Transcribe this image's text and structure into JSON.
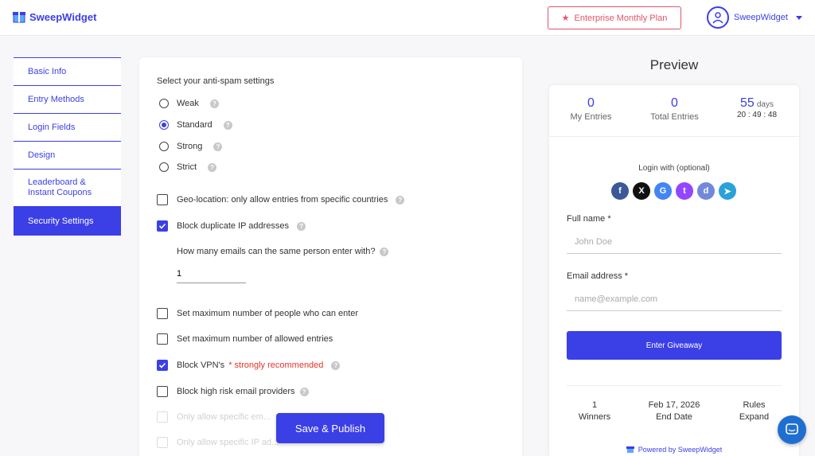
{
  "header": {
    "logo_text": "SweepWidget",
    "plan_label": "Enterprise Monthly Plan",
    "user_name": "SweepWidget"
  },
  "sidebar": {
    "items": [
      {
        "label": "Basic Info"
      },
      {
        "label": "Entry Methods"
      },
      {
        "label": "Login Fields"
      },
      {
        "label": "Design"
      },
      {
        "label": "Leaderboard &",
        "label2": "Instant Coupons"
      },
      {
        "label": "Security Settings",
        "active": true
      }
    ]
  },
  "security": {
    "title": "Select your anti-spam settings",
    "levels": [
      {
        "label": "Weak",
        "selected": false
      },
      {
        "label": "Standard",
        "selected": true
      },
      {
        "label": "Strong",
        "selected": false
      },
      {
        "label": "Strict",
        "selected": false
      }
    ],
    "options": [
      {
        "label": "Geo-location: only allow entries from specific countries",
        "checked": false
      },
      {
        "label": "Block duplicate IP addresses",
        "checked": true
      },
      {
        "label": "Set maximum number of people who can enter",
        "checked": false
      },
      {
        "label": "Set maximum number of allowed entries",
        "checked": false
      },
      {
        "label": "Block VPN's",
        "checked": true,
        "note": "* strongly recommended"
      },
      {
        "label": "Block high risk email providers",
        "checked": false
      },
      {
        "label": "Only allow specific em...",
        "checked": false
      },
      {
        "label": "Only allow specific IP ad...",
        "checked": false
      }
    ],
    "emails_question": "How many emails can the same person enter with?",
    "emails_value": "1",
    "publish_label": "Save & Publish"
  },
  "preview": {
    "title": "Preview",
    "stats": {
      "my_entries": "0",
      "my_entries_label": "My Entries",
      "total_entries": "0",
      "total_entries_label": "Total Entries",
      "days": "55",
      "days_label": "days",
      "timer": "20 : 49 : 48"
    },
    "login_with": "Login with (optional)",
    "socials": [
      {
        "icon": "facebook-icon",
        "glyph": "f",
        "color": "#3b5998"
      },
      {
        "icon": "x-icon",
        "glyph": "X",
        "color": "#111111"
      },
      {
        "icon": "google-icon",
        "glyph": "G",
        "color": "#4285f4"
      },
      {
        "icon": "twitch-icon",
        "glyph": "t",
        "color": "#9146ff"
      },
      {
        "icon": "discord-icon",
        "glyph": "d",
        "color": "#7289da"
      },
      {
        "icon": "telegram-icon",
        "glyph": "➤",
        "color": "#2aa1da"
      }
    ],
    "full_name_label": "Full name *",
    "full_name_placeholder": "John Doe",
    "email_label": "Email address *",
    "email_placeholder": "name@example.com",
    "enter_label": "Enter Giveaway",
    "footer": {
      "winners": "1",
      "winners_label": "Winners",
      "end_date": "Feb 17, 2026",
      "end_date_label": "End Date",
      "rules": "Rules",
      "rules_label": "Expand"
    },
    "powered_by": "Powered by SweepWidget"
  },
  "colors": {
    "accent": "#3b3fe6",
    "plan": "#e1556a",
    "warning": "#e3352b"
  }
}
